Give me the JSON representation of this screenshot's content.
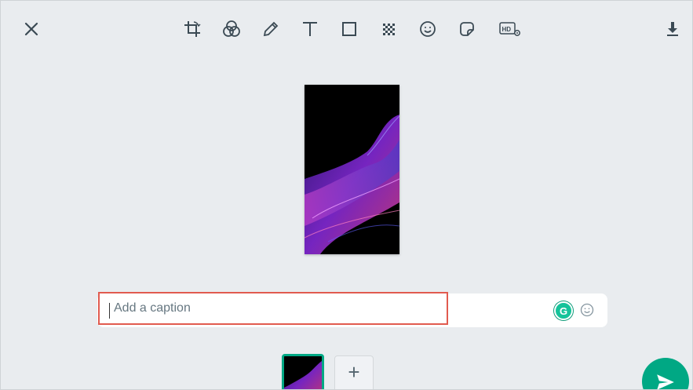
{
  "toolbar": {
    "close_icon": "close-icon",
    "tools": [
      "crop-rotate-icon",
      "filters-icon",
      "pencil-icon",
      "text-icon",
      "rectangle-icon",
      "blur-icon",
      "emoji-icon",
      "sticker-icon",
      "hd-settings-icon"
    ],
    "download_icon": "download-icon"
  },
  "caption": {
    "placeholder": "Add a caption",
    "value": ""
  },
  "grammarly": {
    "letter": "G",
    "color": "#15c39a"
  },
  "thumbnails": {
    "add_label": "+"
  },
  "colors": {
    "accent": "#00a884",
    "highlight": "#e15b4f",
    "background": "#e9ecef"
  }
}
